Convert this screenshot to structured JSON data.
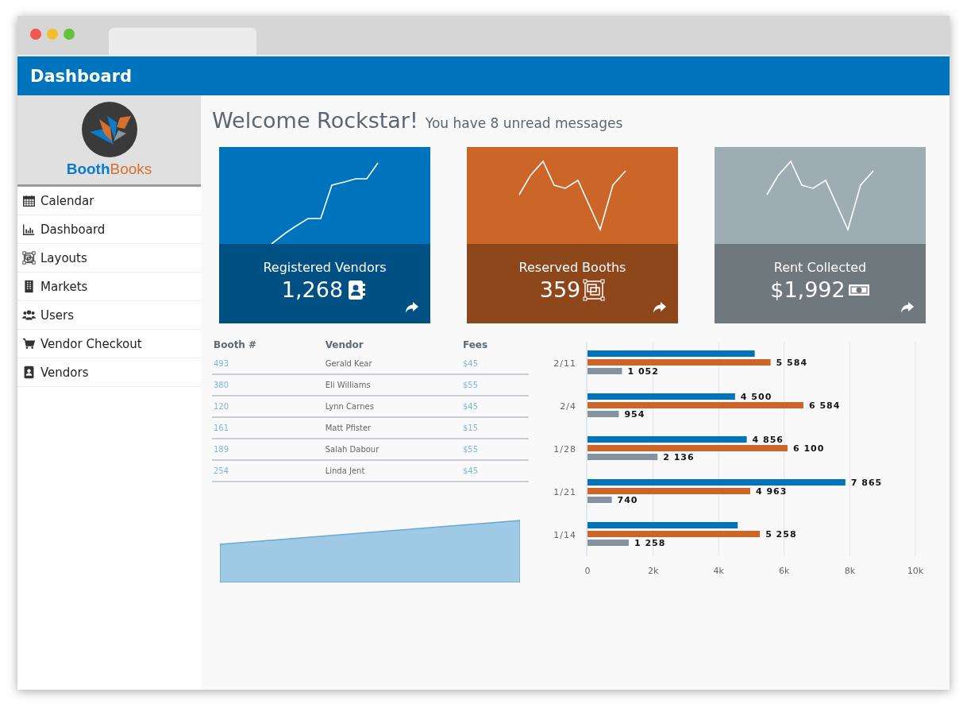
{
  "header": {
    "title": "Dashboard"
  },
  "logo": {
    "part_1": "Booth",
    "part_2": "Books"
  },
  "sidebar": {
    "items": [
      {
        "label": "Calendar"
      },
      {
        "label": "Dashboard"
      },
      {
        "label": "Layouts"
      },
      {
        "label": "Markets"
      },
      {
        "label": "Users"
      },
      {
        "label": "Vendor Checkout"
      },
      {
        "label": "Vendors"
      }
    ]
  },
  "welcome": {
    "title": "Welcome Rockstar!",
    "subtitle": "You have 8 unread messages"
  },
  "cards": [
    {
      "label": "Registered Vendors",
      "value": "1,268",
      "color": "#0073bd"
    },
    {
      "label": "Reserved Booths",
      "value": "359",
      "color": "#cb6628"
    },
    {
      "label": "Rent Collected",
      "value": "$1,992",
      "color": "#9eacb4"
    }
  ],
  "table": {
    "columns": [
      "Booth #",
      "Vendor",
      "Fees"
    ],
    "rows": [
      [
        "493",
        "Gerald Kear",
        "$45"
      ],
      [
        "380",
        "Eli Williams",
        "$55"
      ],
      [
        "120",
        "Lynn Carnes",
        "$45"
      ],
      [
        "161",
        "Matt Pfister",
        "$15"
      ],
      [
        "189",
        "Salah Dabour",
        "$55"
      ],
      [
        "254",
        "Linda Jent",
        "$45"
      ]
    ]
  },
  "bar_chart": {
    "chart_data": {
      "type": "bar",
      "orientation": "horizontal",
      "categories": [
        "2/11",
        "2/4",
        "1/28",
        "1/21",
        "1/14"
      ],
      "series": [
        {
          "color": "#0073bd",
          "values": [
            5100,
            4500,
            4856,
            7865,
            4580
          ],
          "value_labels": [
            null,
            "4 500",
            "4 856",
            "7 865",
            null
          ]
        },
        {
          "color": "#cb6628",
          "values": [
            5584,
            6584,
            6100,
            4963,
            5258
          ],
          "value_labels": [
            "5 584",
            "6 584",
            "6 100",
            "4 963",
            "5 258"
          ]
        },
        {
          "color": "#8593a0",
          "values": [
            1052,
            954,
            2136,
            740,
            1258
          ],
          "value_labels": [
            "1 052",
            "954",
            "2 136",
            "740",
            "1 258"
          ]
        }
      ],
      "xlim": [
        0,
        10000
      ],
      "grid": true,
      "xticks": [
        {
          "value": 0,
          "label": "0"
        },
        {
          "value": 2000,
          "label": "2k"
        },
        {
          "value": 4000,
          "label": "4k"
        },
        {
          "value": 6000,
          "label": "6k"
        },
        {
          "value": 8000,
          "label": "8k"
        },
        {
          "value": 10000,
          "label": "10k"
        }
      ]
    }
  }
}
